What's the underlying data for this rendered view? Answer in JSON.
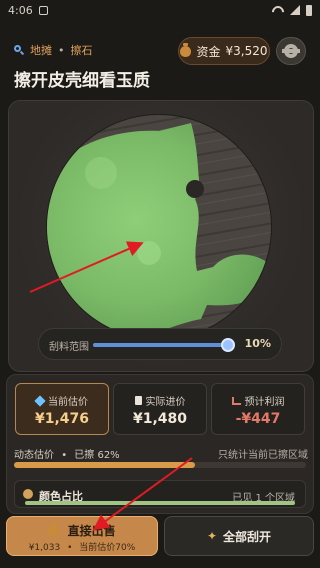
{
  "status": {
    "time": "4:06"
  },
  "header": {
    "breadcrumb": [
      "地摊",
      "擦石"
    ],
    "breadcrumb_sep": "•",
    "title": "擦开皮壳细看玉质",
    "funds_label": "资金",
    "funds_value": "¥3,520"
  },
  "scrape": {
    "label": "刮料范围",
    "value_text": "10%",
    "value": 0.1
  },
  "stats": [
    {
      "label": "当前估价",
      "value": "¥1,476",
      "icon": "gem-icon"
    },
    {
      "label": "实际进价",
      "value": "¥1,480",
      "icon": "receipt-icon"
    },
    {
      "label": "预计利润",
      "value": "-¥447",
      "icon": "chart-icon"
    }
  ],
  "estimate": {
    "label": "动态估价",
    "sep": "•",
    "scraped": "已擦 62%",
    "note": "只统计当前已擦区域",
    "progress": 0.62
  },
  "color_ratio": {
    "title": "颜色占比",
    "note": "已见 1 个区域"
  },
  "actions": {
    "sell_label": "直接出售",
    "sell_price": "¥1,033",
    "sell_sep": "•",
    "sell_ratio": "当前估价70%",
    "scrape_all_label": "全部刮开"
  },
  "colors": {
    "jade": "#7db86a",
    "accent": "#c6874a",
    "arrow": "#e01b24"
  }
}
